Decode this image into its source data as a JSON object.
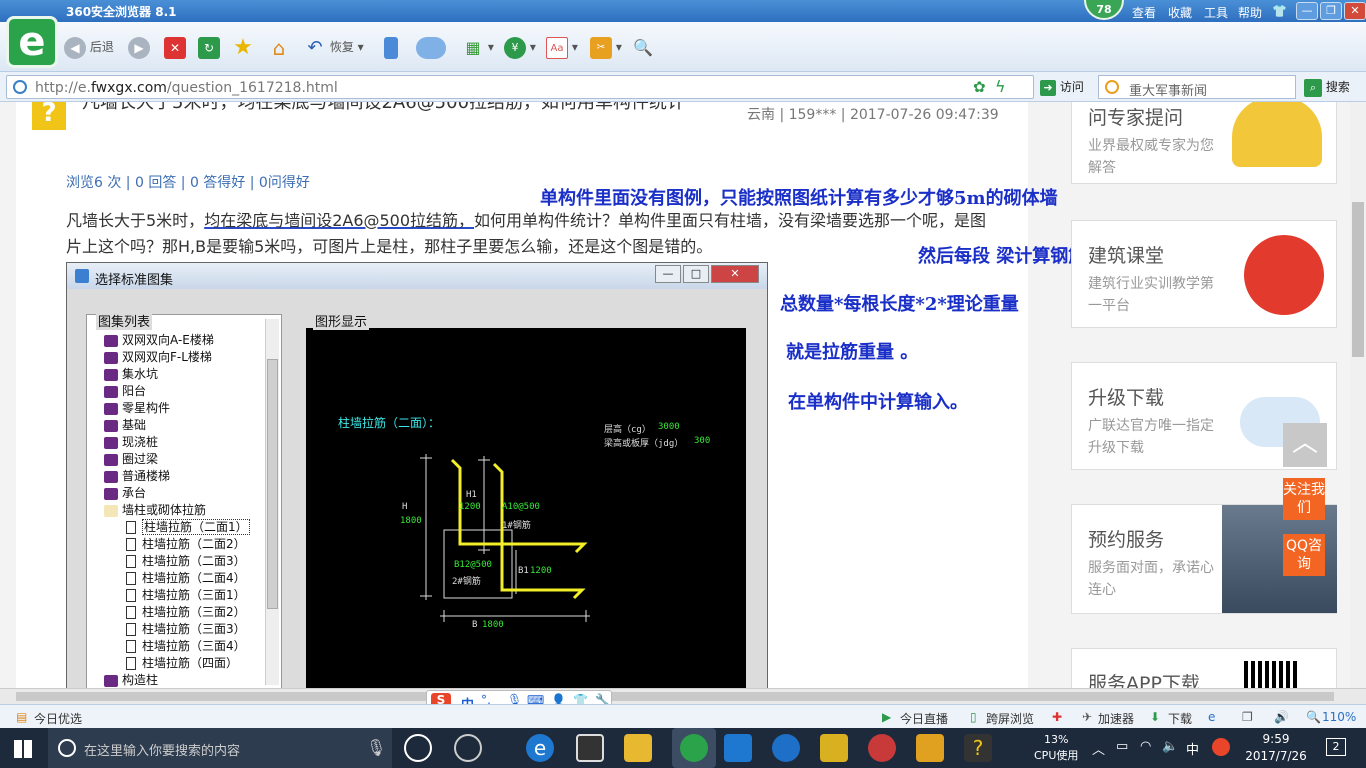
{
  "browser": {
    "title": "360安全浏览器 8.1",
    "badge": "78",
    "menu": [
      "查看",
      "收藏",
      "工具",
      "帮助"
    ],
    "back": "后退",
    "restore": "恢复",
    "url_prefix": "http://e.",
    "url_domain": "fwxgx.com",
    "url_path": "/question_1617218.html",
    "visit": "访问",
    "search_placeholder": "重大军事新闻",
    "search_button": "搜索",
    "zoom": "110%"
  },
  "question": {
    "title": "凡墙长大于5米时，均在梁底与墙间设2A6@500拉结筋，如何用单构件统计",
    "meta": "云南 | 159*** | 2017-07-26 09:47:39",
    "stats": "浏览6 次 | 0 回答 | 0 答得好 | 0问得好",
    "text_before": "凡墙长大于5米时，",
    "text_highlight": "均在梁底与墙间设2A6@500拉结筋，",
    "text_after": "如何用单构件统计？单构件里面只有柱墙，没有梁墙要选那一个呢，是图片上这个吗？那H,B是要输5米吗，可图片上是柱，那柱子里要怎么输，还是这个图是错的。"
  },
  "annotations": [
    "单构件里面没有图例，只能按照图纸计算有多少才够5m的砌体墙",
    "然后每段 梁计算钢筋的根数",
    "总数量*每根长度*2*理论重量",
    "就是拉筋重量 。",
    "在单构件中计算输入。"
  ],
  "dialog": {
    "title": "选择标准图集",
    "list_label": "图集列表",
    "graphic_label": "图形显示",
    "tree": [
      {
        "label": "双网双向A-E楼梯",
        "type": "book"
      },
      {
        "label": "双网双向F-L楼梯",
        "type": "book"
      },
      {
        "label": "集水坑",
        "type": "book"
      },
      {
        "label": "阳台",
        "type": "book"
      },
      {
        "label": "零星构件",
        "type": "book"
      },
      {
        "label": "基础",
        "type": "book"
      },
      {
        "label": "现浇桩",
        "type": "book"
      },
      {
        "label": "圈过梁",
        "type": "book"
      },
      {
        "label": "普通楼梯",
        "type": "book"
      },
      {
        "label": "承台",
        "type": "book"
      },
      {
        "label": "墙柱或砌体拉筋",
        "type": "open"
      },
      {
        "label": "柱墙拉筋（二面1）",
        "type": "doc",
        "selected": true
      },
      {
        "label": "柱墙拉筋（二面2）",
        "type": "doc"
      },
      {
        "label": "柱墙拉筋（二面3）",
        "type": "doc"
      },
      {
        "label": "柱墙拉筋（二面4）",
        "type": "doc"
      },
      {
        "label": "柱墙拉筋（三面1）",
        "type": "doc"
      },
      {
        "label": "柱墙拉筋（三面2）",
        "type": "doc"
      },
      {
        "label": "柱墙拉筋（三面3）",
        "type": "doc"
      },
      {
        "label": "柱墙拉筋（三面4）",
        "type": "doc"
      },
      {
        "label": "柱墙拉筋（四面）",
        "type": "doc"
      },
      {
        "label": "构造柱",
        "type": "book"
      }
    ],
    "cad": {
      "title": "柱墙拉筋（二面）：",
      "floor_height": "层高（cg）",
      "floor_height_val": "3000",
      "beam_height": "梁高或板厚（jdg）",
      "beam_height_val": "300",
      "h": "H",
      "h_val": "1800",
      "h1": "H1",
      "h1_val": "1200",
      "a_spec": "A10@500",
      "bar1": "1#钢筋",
      "b_spec": "B12@500",
      "bar2": "2#钢筋",
      "b1": "B1",
      "b1_val": "1200",
      "b": "B",
      "b_val": "1800"
    }
  },
  "sidebar": [
    {
      "title": "问专家提问",
      "desc": "业界最权威专家为您解答"
    },
    {
      "title": "建筑课堂",
      "desc": "建筑行业实训教学第一平台"
    },
    {
      "title": "升级下载",
      "desc": "广联达官方唯一指定升级下载"
    },
    {
      "title": "预约服务",
      "desc": "服务面对面，承诺心连心"
    },
    {
      "title": "服务APP下载",
      "desc": ""
    }
  ],
  "float_buttons": [
    "关注我们",
    "QQ咨询"
  ],
  "ime": {
    "label": "中"
  },
  "statusbar": {
    "left": "今日优选",
    "items": [
      "今日直播",
      "跨屏浏览",
      "加速器",
      "下载"
    ]
  },
  "taskbar": {
    "search_placeholder": "在这里输入你要搜索的内容",
    "cpu_percent": "13%",
    "cpu_label": "CPU使用",
    "ime": "中",
    "time": "9:59",
    "date": "2017/7/26",
    "notifications": "2"
  },
  "colors": {
    "annotation": "#1a2fc8",
    "cad_yellow": "#f2ee28",
    "cad_green": "#38e838",
    "cad_cyan": "#3ce8e8",
    "accent_orange": "#f26522",
    "browser_green": "#2ba34a"
  }
}
